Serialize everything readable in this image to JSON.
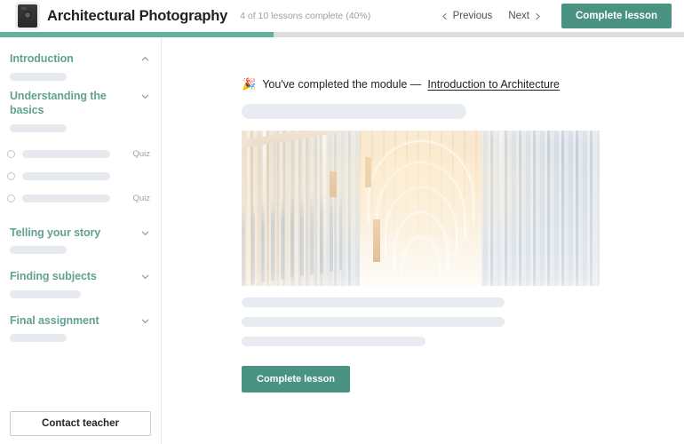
{
  "header": {
    "logo_icon": "camera-logo-icon",
    "course_title": "Architectural Photography",
    "progress_text": "4 of 10 lessons complete (40%)",
    "previous_label": "Previous",
    "next_label": "Next",
    "complete_lesson_label": "Complete lesson",
    "prev_icon": "chevron-left-icon",
    "next_icon": "chevron-right-icon"
  },
  "progress": {
    "percent": 40,
    "fill_color": "#63b09d",
    "track_color": "#dcdddf"
  },
  "sidebar": {
    "sections": [
      {
        "title": "Introduction",
        "state": "expanded",
        "chevron": "chevron-up-icon"
      },
      {
        "title": "Understanding the basics",
        "state": "collapsed",
        "chevron": "chevron-down-icon"
      },
      {
        "title": "Telling your story",
        "state": "collapsed",
        "chevron": "chevron-down-icon"
      },
      {
        "title": "Finding subjects",
        "state": "collapsed",
        "chevron": "chevron-down-icon"
      },
      {
        "title": "Final assignment",
        "state": "collapsed",
        "chevron": "chevron-down-icon"
      }
    ],
    "lessons": [
      {
        "tag": "Quiz",
        "status_icon": "radio-empty-icon"
      },
      {
        "tag": "",
        "status_icon": "radio-empty-icon"
      },
      {
        "tag": "Quiz",
        "status_icon": "radio-empty-icon"
      }
    ],
    "contact_teacher_label": "Contact teacher",
    "heading_color": "#62a193"
  },
  "main": {
    "party_icon": "🎉",
    "heading_prefix": "You've completed the module —",
    "module_link": "Introduction to Architecture",
    "hero_image_alt": "architectural-interior-photo",
    "complete_lesson_label": "Complete lesson"
  },
  "theme": {
    "accent": "#4a9383",
    "skeleton": "#e8ecf1",
    "text": "#1f2024",
    "muted": "#9aa0a6"
  }
}
